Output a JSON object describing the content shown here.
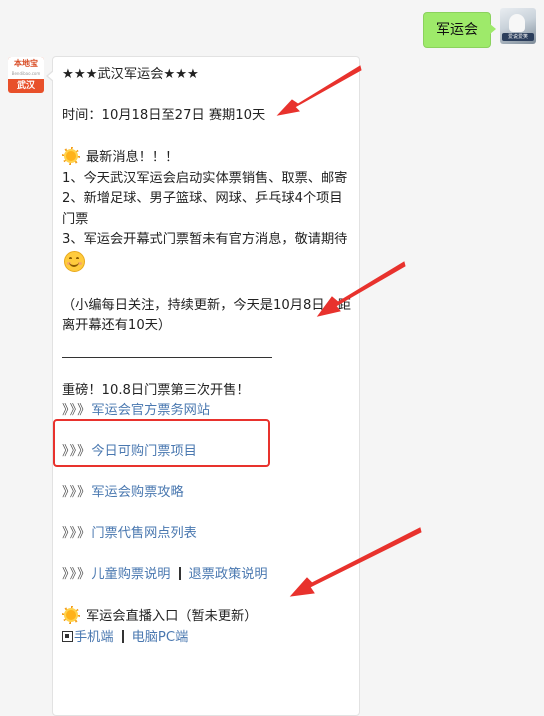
{
  "outgoing": {
    "message": "军运会",
    "avatar_caption": "爱说爱笑"
  },
  "bot": {
    "avatar_brand": "本地宝",
    "avatar_site": "Bendibao.com",
    "avatar_city": "武汉"
  },
  "message": {
    "title": "★★★武汉军运会★★★",
    "time": "时间：10月18日至27日 赛期10天",
    "news_heading": "最新消息！！！",
    "news_items": [
      "1、今天武汉军运会启动实体票销售、取票、邮寄",
      "2、新增足球、男子篮球、网球、乒乓球4个项目门票",
      "3、军运会开幕式门票暂未有官方消息，敬请期待"
    ],
    "note": "（小编每日关注，持续更新，今天是10月8日，距离开幕还有10天）",
    "highlight_text": "重磅！10.8日门票第三次开售！",
    "arrow_prefix": "》》》",
    "links": {
      "official": "军运会官方票务网站",
      "today": "今日可购门票项目",
      "guide": "军运会购票攻略",
      "outlets": "门票代售网点列表",
      "kids": "儿童购票说明",
      "refund": "退票政策说明"
    },
    "live_heading": "军运会直播入口（暂未更新）",
    "live_mobile": "手机端",
    "live_pc": "电脑PC端"
  },
  "colors": {
    "outgoing_bubble": "#9eea6a",
    "link": "#4a78b0",
    "annotation_red": "#e8322d",
    "background": "#f5f5f5"
  }
}
